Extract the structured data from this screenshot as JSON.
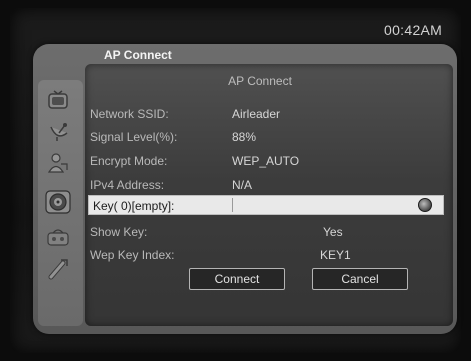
{
  "status": {
    "clock": "00:42AM"
  },
  "window": {
    "title": "AP Connect"
  },
  "dialog": {
    "title": "AP Connect",
    "fields": [
      {
        "label": "Network SSID:",
        "value": "Airleader"
      },
      {
        "label": "Signal Level(%):",
        "value": "88%"
      },
      {
        "label": "Encrypt Mode:",
        "value": "WEP_AUTO"
      },
      {
        "label": "IPv4 Address:",
        "value": "N/A"
      }
    ],
    "key_field": {
      "label": "Key( 0)[empty]:"
    },
    "show_key": {
      "label": "Show Key:",
      "value": "Yes"
    },
    "wep_key_index": {
      "label": "Wep Key Index:",
      "value": "KEY1"
    },
    "buttons": {
      "connect": "Connect",
      "cancel": "Cancel"
    }
  },
  "sidebar": {
    "icons": [
      "tv-icon",
      "satellite-dish-icon",
      "user-network-icon",
      "settings-disc-icon",
      "media-icon",
      "tools-icon"
    ]
  }
}
